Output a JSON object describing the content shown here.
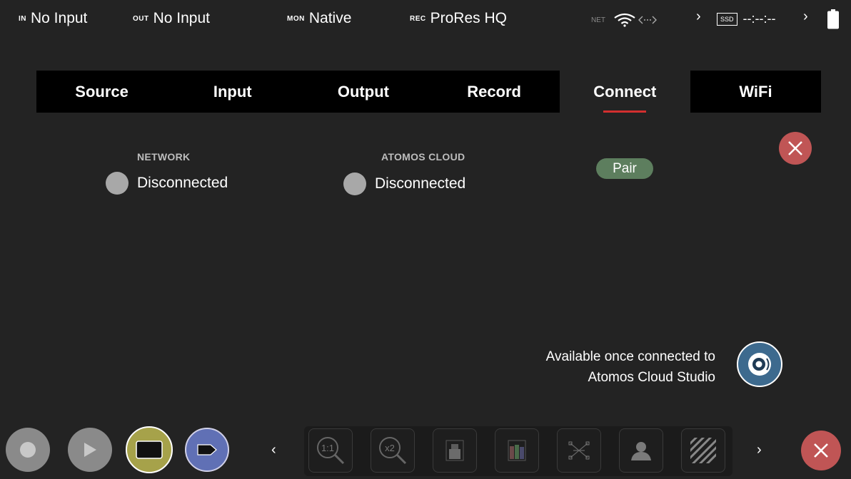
{
  "status_bar": {
    "in_tag": "IN",
    "in_value": "No Input",
    "out_tag": "OUT",
    "out_value": "No Input",
    "mon_tag": "MON",
    "mon_value": "Native",
    "rec_tag": "REC",
    "rec_value": "ProRes HQ",
    "net_tag": "NET",
    "ssd_label": "SSD",
    "timecode": "--:--:--"
  },
  "tabs": [
    {
      "label": "Source"
    },
    {
      "label": "Input"
    },
    {
      "label": "Output"
    },
    {
      "label": "Record"
    },
    {
      "label": "Connect",
      "active": true
    },
    {
      "label": "WiFi"
    }
  ],
  "connect": {
    "network_heading": "NETWORK",
    "network_status": "Disconnected",
    "cloud_heading": "ATOMOS CLOUD",
    "cloud_status": "Disconnected",
    "pair_label": "Pair",
    "cloud_note_line1": "Available once connected to",
    "cloud_note_line2": "Atomos Cloud Studio"
  },
  "toolbar": {
    "tools": [
      {
        "icon": "zoom-1to1-icon",
        "label": "1:1"
      },
      {
        "icon": "zoom-x2-icon",
        "label": "x2"
      },
      {
        "icon": "waveform-icon"
      },
      {
        "icon": "rgb-parade-icon"
      },
      {
        "icon": "vectorscope-icon"
      },
      {
        "icon": "false-color-icon"
      },
      {
        "icon": "zebra-icon"
      }
    ]
  },
  "colors": {
    "accent_red": "#d32f2f",
    "close_red": "#c05555",
    "pair_green": "#5d7e5e",
    "monitor_yellow": "#a6a24a",
    "tag_blue": "#6070b5",
    "cloud_blue": "#3d6a8e"
  }
}
